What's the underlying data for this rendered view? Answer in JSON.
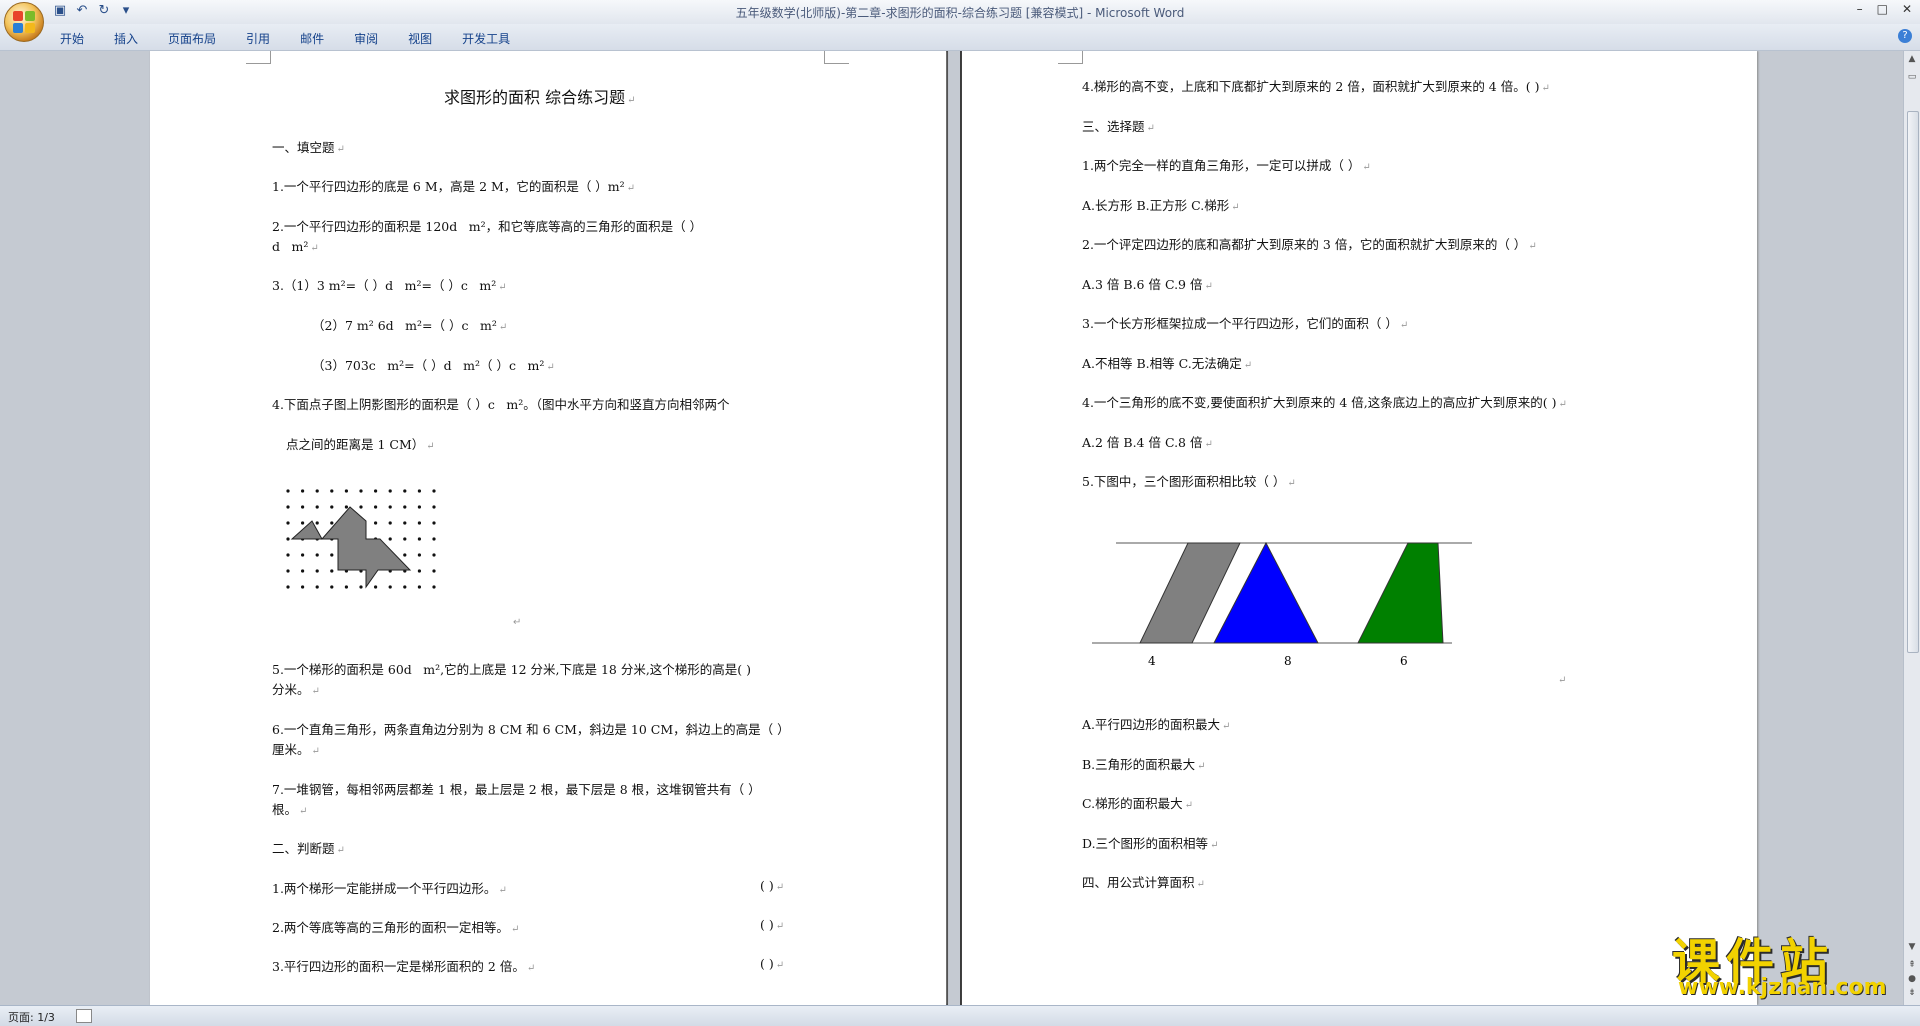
{
  "window": {
    "title": "五年级数学(北师版)-第二章-求图形的面积-综合练习题 [兼容模式] - Microsoft Word",
    "controls": [
      "–",
      "□",
      "✕"
    ]
  },
  "qat": {
    "save_icon": "save-icon",
    "undo_icon": "undo-icon",
    "redo_icon": "redo-icon",
    "more": "▾"
  },
  "ribbon": {
    "tabs": [
      "开始",
      "插入",
      "页面布局",
      "引用",
      "邮件",
      "审阅",
      "视图",
      "开发工具"
    ]
  },
  "page1": {
    "title": "求图形的面积  综合练习题",
    "s1": "一、填空题",
    "q1": "1.一个平行四边形的底是 6 M，高是 2 M，它的面积是（             ）m²",
    "q2a": "2.一个平行四边形的面积是 120dㅤm²，和它等底等高的三角形的面积是（                    ）",
    "q2b": "dㅤm²",
    "q3a": "3.（1）3 m²=（             ）dㅤm²=（             ）cㅤm²",
    "q3b": "（2）7 m² 6dㅤm²=（              ）cㅤm²",
    "q3c": "（3）703cㅤm²=（              ）dㅤm²（                ）cㅤm²",
    "q4a": "4.下面点子图上阴影图形的面积是（           ）cㅤm²。（图中水平方向和竖直方向相邻两个",
    "q4b": "点之间的距离是 1 CM）",
    "q5a": "5.一个梯形的面积是 60dㅤm²,它的上底是 12 分米,下底是 18 分米,这个梯形的高是(          )",
    "q5b": "分米。",
    "q6a": "6.一个直角三角形，两条直角边分别为 8 CM 和 6 CM，斜边是 10 CM，斜边上的高是（          ）",
    "q6b": "厘米。",
    "q7a": "7.一堆钢管，每相邻两层都差 1 根，最上层是 2 根，最下层是 8 根，这堆钢管共有（          ）",
    "q7b": "根。",
    "s2": "二、判断题",
    "j1": "1.两个梯形一定能拼成一个平行四边形。",
    "j2": "2.两个等底等高的三角形的面积一定相等。",
    "j3": "3.平行四边形的面积一定是梯形面积的 2 倍。",
    "paren": "(          )"
  },
  "page2": {
    "j4": "4.梯形的高不变，上底和下底都扩大到原来的 2 倍，面积就扩大到原来的 4 倍。(          )",
    "s3": "三、选择题",
    "c1": "1.两个完全一样的直角三角形，一定可以拼成（      ）",
    "c1o": "A.长方形    B.正方形    C.梯形",
    "c2": "2.一个评定四边形的底和高都扩大到原来的 3 倍，它的面积就扩大到原来的（      ）",
    "c2o": "A.3 倍    B.6 倍    C.9 倍",
    "c3": "3.一个长方形框架拉成一个平行四边形，它们的面积（      ）",
    "c3o": "A.不相等    B.相等    C.无法确定",
    "c4": "4.一个三角形的底不变,要使面积扩大到原来的 4 倍,这条底边上的高应扩大到原来的(      )",
    "c4o": "A.2 倍    B.4 倍    C.8 倍",
    "c5": "5.下图中，三个图形面积相比较（      ）",
    "fig_labels": [
      "4",
      "8",
      "6"
    ],
    "a": "A.平行四边形的面积最大",
    "b": "B.三角形的面积最大",
    "c": "C.梯形的面积最大",
    "d": "D.三个图形的面积相等",
    "s4": "四、用公式计算面积"
  },
  "colors": {
    "parallelogram": "#808080",
    "triangle": "#0000ff",
    "trapezoid": "#008000",
    "dot_shape": "#808080"
  },
  "status": {
    "page": "页面: 1/3"
  },
  "watermark": {
    "cn": "课件站",
    "url": "www.kjzhan.com"
  }
}
